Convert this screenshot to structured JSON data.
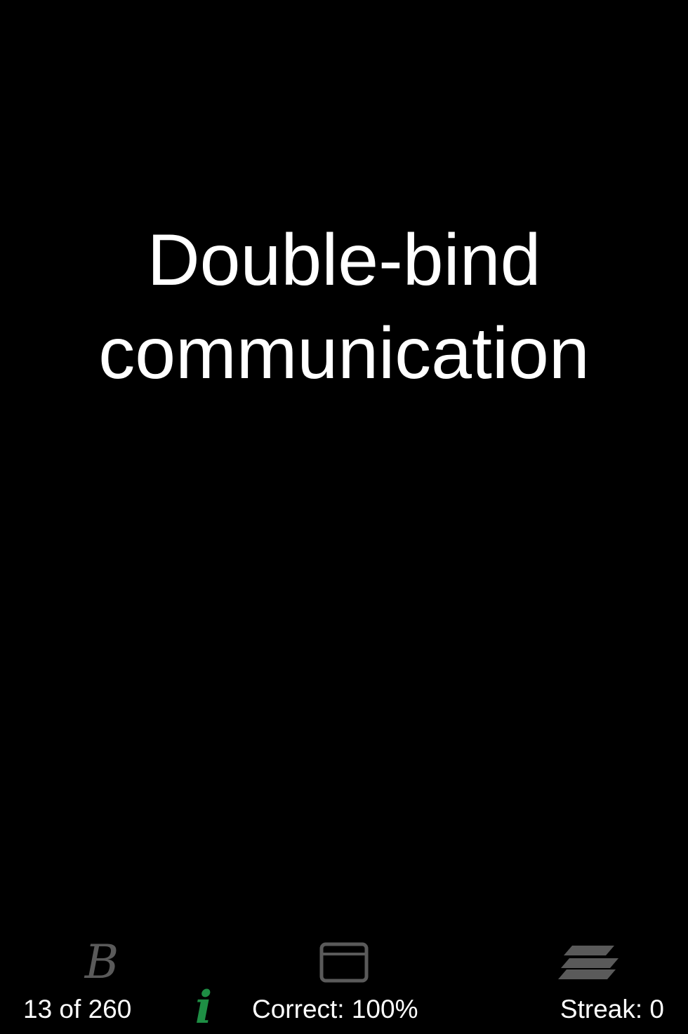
{
  "card": {
    "term_line1": "Double-bind",
    "term_line2": "communication"
  },
  "toolbar": {
    "icons": {
      "bold": "letter-b-icon",
      "card": "card-view-icon",
      "stack": "stack-icon",
      "info": "info-icon"
    },
    "bold_glyph": "B",
    "info_glyph": "i",
    "progress": "13 of 260",
    "correct": "Correct: 100%",
    "streak": "Streak: 0"
  },
  "colors": {
    "background": "#000000",
    "text": "#ffffff",
    "icon_gray": "#5a5a5a",
    "info_green": "#1e8e44"
  }
}
